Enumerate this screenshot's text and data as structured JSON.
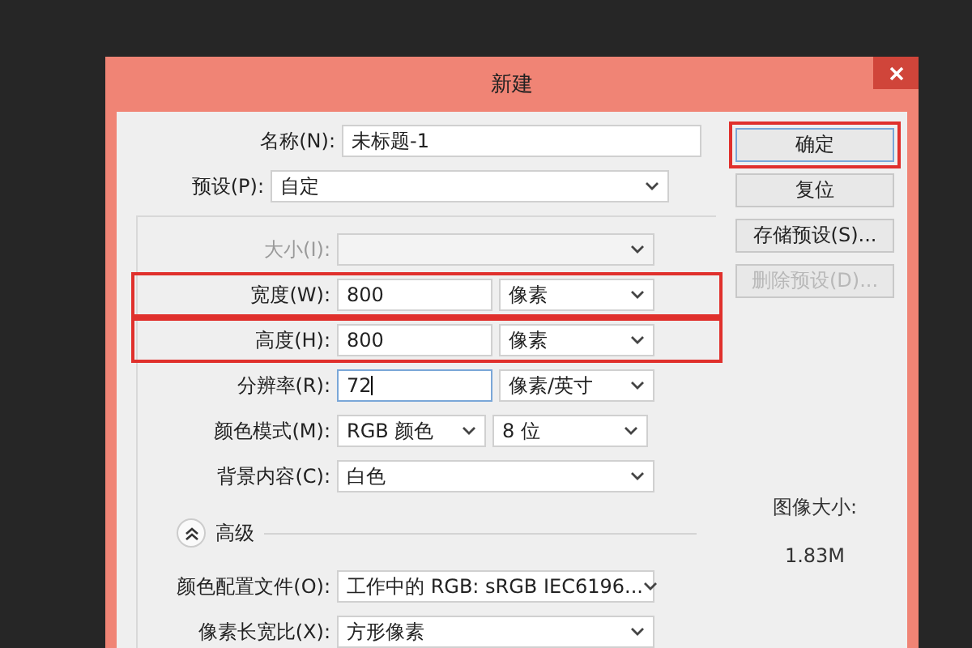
{
  "window": {
    "title": "新建"
  },
  "name": {
    "label": "名称(N):",
    "value": "未标题-1"
  },
  "preset": {
    "label": "预设(P):",
    "value": "自定"
  },
  "rows": [
    {
      "kind": "select",
      "label": "大小(I):",
      "disabled": true,
      "highlighted": false
    },
    {
      "kind": "input_unit",
      "label": "宽度(W):",
      "value": "800",
      "unit": "像素",
      "disabled": false,
      "highlighted": true,
      "focused": false
    },
    {
      "kind": "input_unit",
      "label": "高度(H):",
      "value": "800",
      "unit": "像素",
      "disabled": false,
      "highlighted": true,
      "focused": false
    },
    {
      "kind": "input_unit",
      "label": "分辨率(R):",
      "value": "72",
      "unit": "像素/英寸",
      "disabled": false,
      "highlighted": false,
      "focused": true
    },
    {
      "kind": "select_pair",
      "label": "颜色模式(M):",
      "value": "RGB 颜色",
      "unit": "8 位",
      "disabled": false,
      "highlighted": false
    },
    {
      "kind": "select",
      "label": "背景内容(C):",
      "value": "白色",
      "disabled": false,
      "highlighted": false
    }
  ],
  "advanced": {
    "label": "高级",
    "expanded": true,
    "rows": [
      {
        "kind": "select",
        "label": "颜色配置文件(O):",
        "value": "工作中的 RGB: sRGB IEC6196...",
        "disabled": false,
        "highlighted": false
      },
      {
        "kind": "select",
        "label": "像素长宽比(X):",
        "value": "方形像素",
        "disabled": false,
        "highlighted": false
      }
    ]
  },
  "buttons": [
    {
      "label": "确定",
      "default": true,
      "disabled": false,
      "highlighted": true
    },
    {
      "label": "复位",
      "default": false,
      "disabled": false,
      "highlighted": false
    },
    {
      "label": "存储预设(S)...",
      "default": false,
      "disabled": false,
      "highlighted": false
    },
    {
      "label": "删除预设(D)...",
      "default": false,
      "disabled": true,
      "highlighted": false
    }
  ],
  "image_size": {
    "label": "图像大小:",
    "value": "1.83M"
  }
}
